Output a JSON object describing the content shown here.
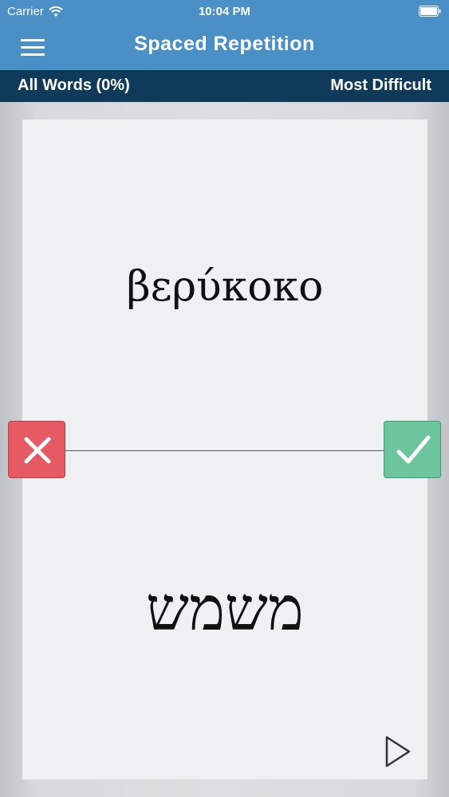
{
  "status_bar": {
    "carrier": "Carrier",
    "time": "10:04 PM",
    "wifi_icon": "wifi-icon",
    "battery_icon": "battery-icon"
  },
  "nav": {
    "title": "Spaced Repetition",
    "menu_icon": "hamburger-menu-icon"
  },
  "filter_bar": {
    "left_label": "All Words (0%)",
    "right_label": "Most Difficult"
  },
  "card": {
    "front_word": "βερύκοκο",
    "back_word": "משמש"
  },
  "actions": {
    "wrong_icon": "close-icon",
    "right_icon": "checkmark-icon",
    "play_icon": "play-icon"
  },
  "colors": {
    "header_blue": "#4a90c6",
    "subbar_navy": "#0f3a5a",
    "wrong_red": "#e65a64",
    "right_green": "#6cc59d",
    "card_bg": "#eff0f2"
  }
}
